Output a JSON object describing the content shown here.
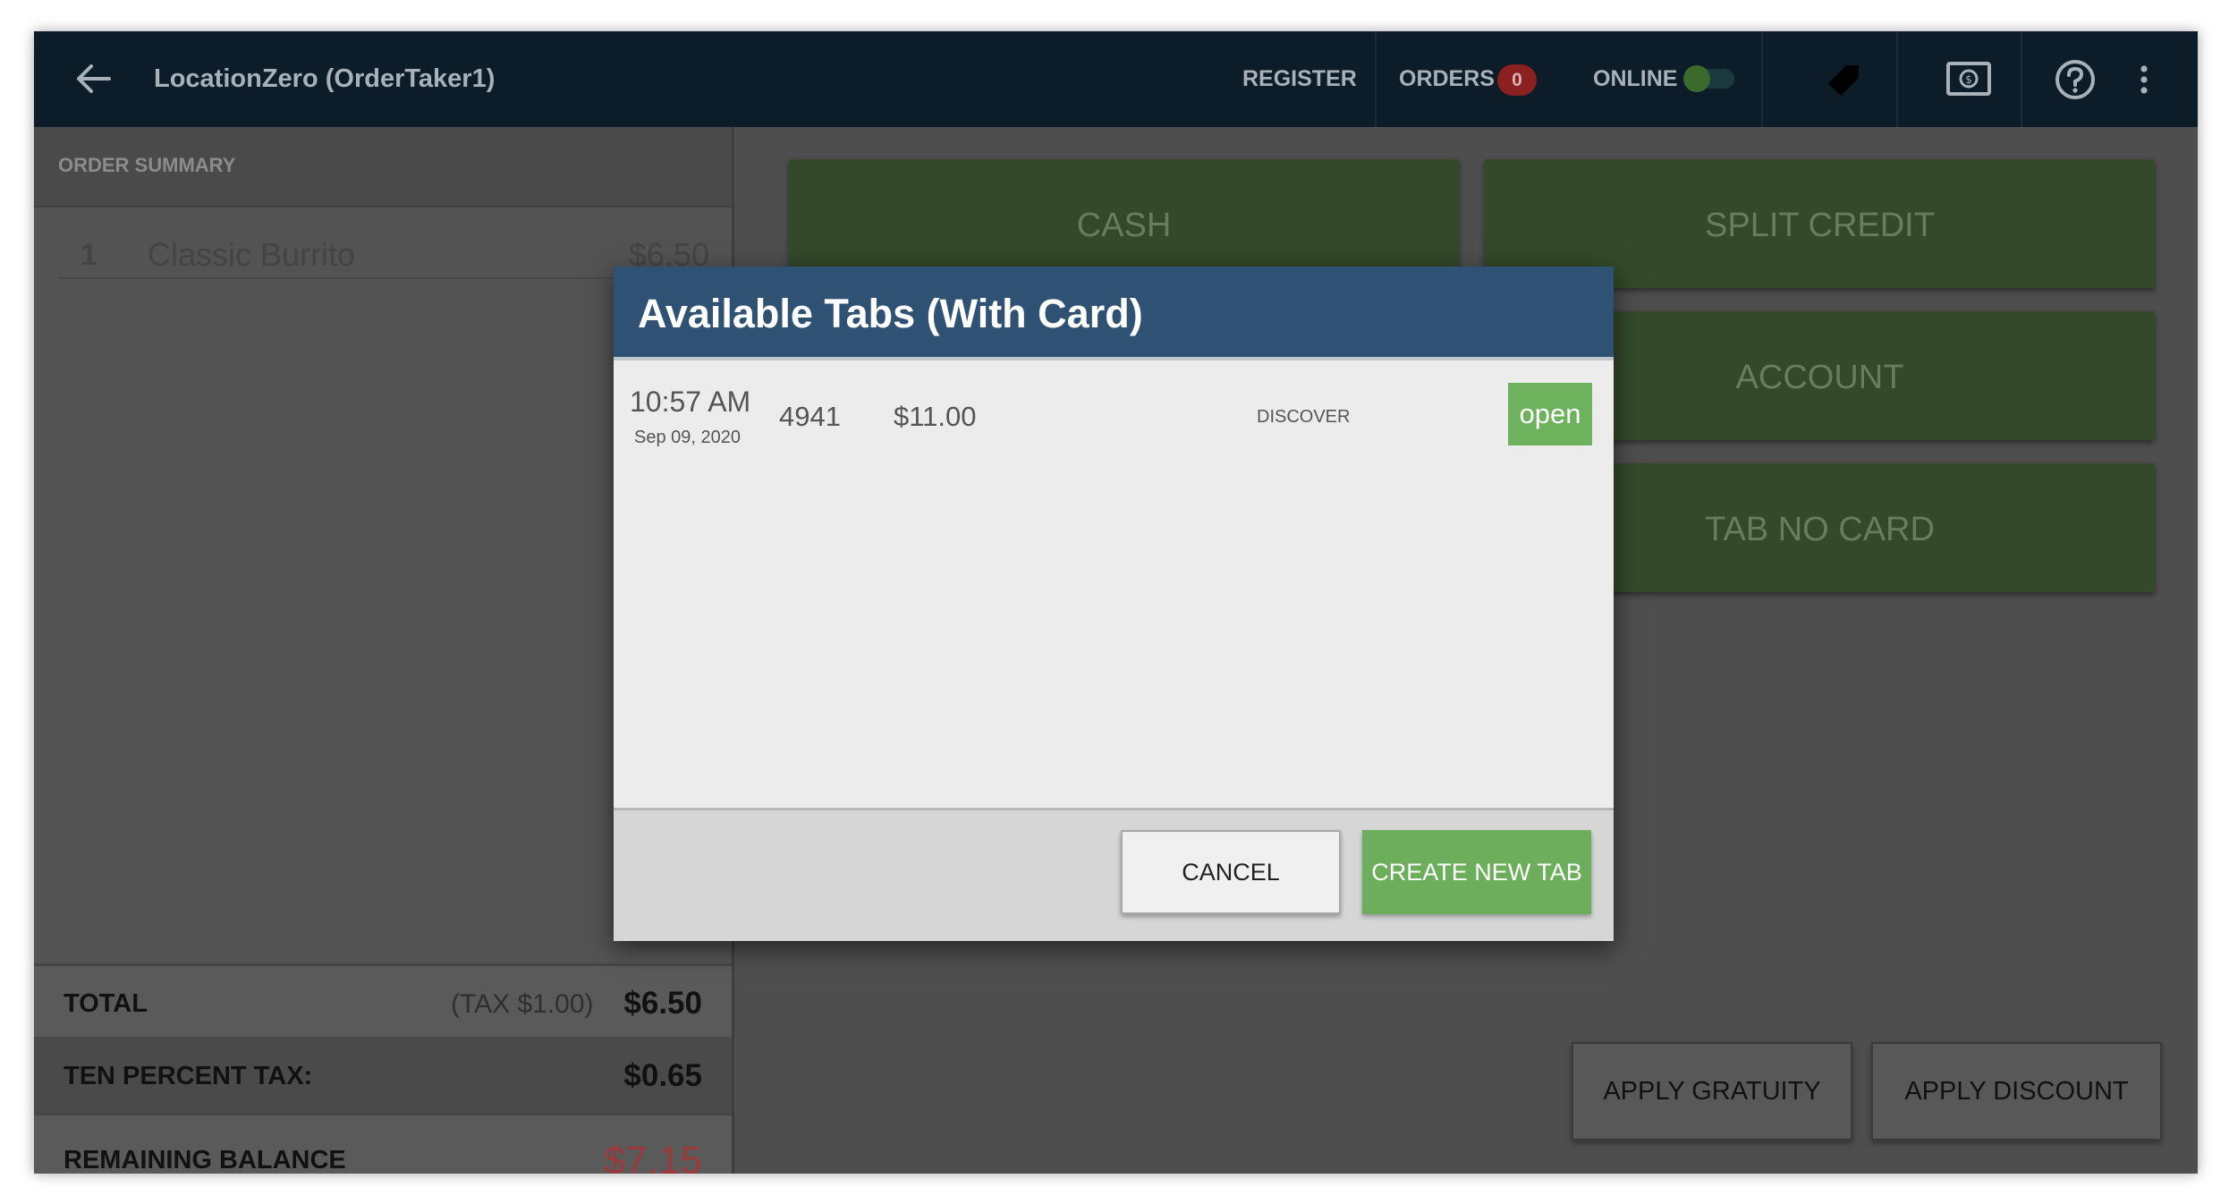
{
  "header": {
    "title": "LocationZero (OrderTaker1)",
    "register_label": "REGISTER",
    "orders_label": "ORDERS",
    "orders_count": "0",
    "online_label": "ONLINE",
    "icons": [
      "back-arrow-icon",
      "tag-icon",
      "cash-drawer-icon",
      "help-icon",
      "more-vert-icon"
    ]
  },
  "order_summary": {
    "heading": "ORDER SUMMARY",
    "items": [
      {
        "qty": "1",
        "name": "Classic Burrito",
        "price": "$6.50"
      }
    ],
    "total_label": "TOTAL",
    "tax_note": "(TAX $1.00)",
    "total_value": "$6.50",
    "tax_label": "TEN PERCENT TAX:",
    "tax_value": "$0.65",
    "balance_label": "REMAINING BALANCE",
    "balance_value": "$7.15"
  },
  "payment_buttons": {
    "cash": "CASH",
    "split_credit": "SPLIT CREDIT",
    "account": "ACCOUNT",
    "tab_no_card": "TAB NO CARD",
    "apply_gratuity": "APPLY GRATUITY",
    "apply_discount": "APPLY DISCOUNT"
  },
  "dialog": {
    "title": "Available Tabs (With Card)",
    "tabs": [
      {
        "time": "10:57 AM",
        "date": "Sep 09, 2020",
        "number": "4941",
        "amount": "$11.00",
        "card": "DISCOVER",
        "status": "open"
      }
    ],
    "cancel_label": "CANCEL",
    "create_label": "CREATE NEW TAB"
  },
  "colors": {
    "topbar": "#0d1c29",
    "dialog_header": "#2f5173",
    "accent_green": "#6cae5c",
    "balance_red": "#9a3a3a"
  }
}
